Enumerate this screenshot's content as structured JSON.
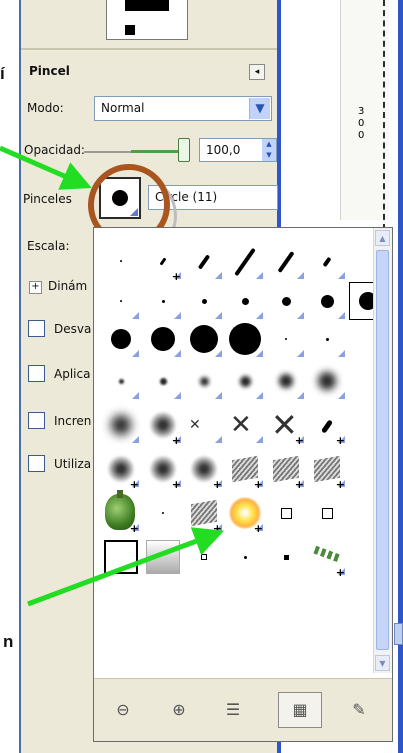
{
  "left_margin": {
    "cut_word_top": "í",
    "cut_word_bottom": "n"
  },
  "panel": {
    "title": "Pincel",
    "mode_label": "Modo:",
    "mode_value": "Normal",
    "opacity_label": "Opacidad:",
    "opacity_value": "100,0",
    "opacity_level_fraction": 1.0,
    "brushes_label": "Pinceles",
    "brush_name": "Circle (11)",
    "scale_label": "Escala:",
    "dynamics_label": "Dinám",
    "options": [
      "Desva",
      "Aplica",
      "Incren",
      "Utiliza"
    ]
  },
  "ruler": {
    "label": "300",
    "line_color": "#2b2b2b"
  },
  "popup": {
    "toolbar_icons": [
      "zoom-out-icon",
      "zoom-in-icon",
      "list-view-icon",
      "grid-view-icon",
      "paintbrush-icon"
    ],
    "active_view": "grid-view-icon"
  },
  "annotation": {
    "ring_color": "#a9551f",
    "arrow_color": "#22dd22"
  },
  "colors": {
    "accent": "#2f56c9",
    "dock_bg": "#ece9d8"
  }
}
